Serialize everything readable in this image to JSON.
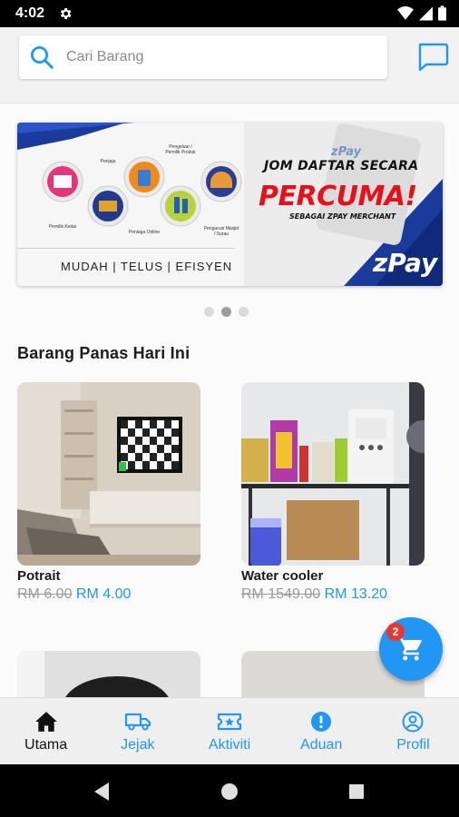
{
  "status_bar": {
    "time": "4:02"
  },
  "search": {
    "placeholder": "Cari Barang"
  },
  "banner": {
    "headline": "JOM DAFTAR SECARA",
    "highlight": "PERCUMA!",
    "subline": "SEBAGAI ZPAY MERCHANT",
    "tagline": "MUDAH | TELUS | EFISYEN",
    "brand": "zPay",
    "icon_labels": [
      "Pemilik Kedai",
      "Penjaja",
      "Peniaga Online",
      "Pengeluar / Pemilik Produk",
      "Pengurusi Masjid / Surau"
    ]
  },
  "carousel": {
    "count": 3,
    "active": 1
  },
  "section": {
    "title": "Barang Panas Hari Ini"
  },
  "products": [
    {
      "name": "Potrait",
      "old_price": "RM 6.00",
      "new_price": "RM 4.00"
    },
    {
      "name": "Water cooler",
      "old_price": "RM 1549.00",
      "new_price": "RM 13.20"
    }
  ],
  "cart": {
    "badge": "2"
  },
  "bottom_nav": [
    {
      "label": "Utama",
      "icon": "home-icon",
      "active": true
    },
    {
      "label": "Jejak",
      "icon": "truck-icon",
      "active": false
    },
    {
      "label": "Aktiviti",
      "icon": "ticket-icon",
      "active": false
    },
    {
      "label": "Aduan",
      "icon": "alert-icon",
      "active": false
    },
    {
      "label": "Profil",
      "icon": "profile-icon",
      "active": false
    }
  ],
  "colors": {
    "accent": "#2196f3",
    "badge": "#e53935",
    "banner_red": "#e4111b",
    "banner_blue": "#1a3a9c"
  }
}
